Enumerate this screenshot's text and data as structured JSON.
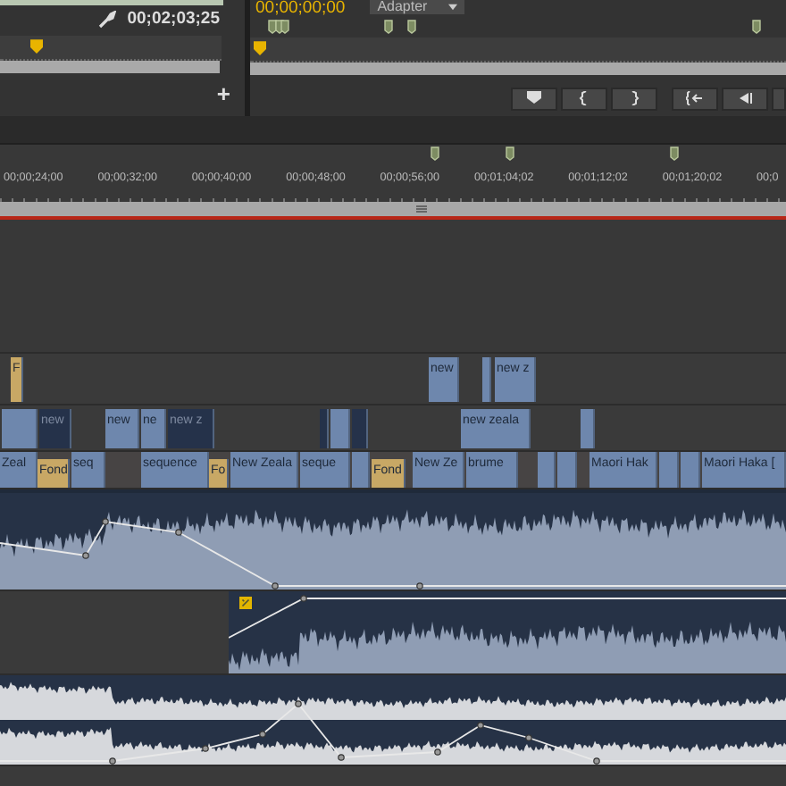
{
  "source_monitor": {
    "timecode": "00;02;03;25",
    "add_button": "+"
  },
  "program_monitor": {
    "timecode": "00;00;00;00",
    "dropdown": "Adapter"
  },
  "timeline": {
    "ruler_labels": [
      "00;00;24;00",
      "00;00;32;00",
      "00;00;40;00",
      "00;00;48;00",
      "00;00;56;00",
      "00;01;04;02",
      "00;01;12;02",
      "00;01;20;02",
      "00;0"
    ],
    "video_tracks": [
      {
        "clips": [
          {
            "label": "F",
            "kind": "gold"
          },
          {
            "label": "new",
            "kind": "normal"
          },
          {
            "kind": "normal"
          },
          {
            "label": "new z",
            "kind": "normal"
          }
        ]
      },
      {
        "clips": [
          {
            "kind": "normal"
          },
          {
            "label": "new",
            "kind": "dark"
          },
          {
            "label": "new",
            "kind": "normal"
          },
          {
            "label": "ne",
            "kind": "normal"
          },
          {
            "label": "new z",
            "kind": "dark"
          },
          {
            "kind": "dark"
          },
          {
            "kind": "normal"
          },
          {
            "kind": "dark"
          },
          {
            "label": "new zeala",
            "kind": "normal"
          },
          {
            "kind": "normal"
          }
        ]
      },
      {
        "clips": [
          {
            "label": "Zeal",
            "kind": "normal"
          },
          {
            "label": "Fond",
            "kind": "gold"
          },
          {
            "label": "seq",
            "kind": "normal"
          },
          {
            "label": "sequence",
            "kind": "normal"
          },
          {
            "label": "Fo",
            "kind": "gold"
          },
          {
            "label": "New Zeala",
            "kind": "normal"
          },
          {
            "label": "seque",
            "kind": "normal"
          },
          {
            "kind": "normal"
          },
          {
            "label": "Fond",
            "kind": "gold"
          },
          {
            "label": "New Ze",
            "kind": "normal"
          },
          {
            "label": "brume",
            "kind": "normal"
          },
          {
            "kind": "normal"
          },
          {
            "kind": "normal"
          },
          {
            "label": "Maori Hak",
            "kind": "normal"
          },
          {
            "kind": "normal"
          },
          {
            "kind": "normal"
          },
          {
            "label": "Maori Haka [",
            "kind": "normal"
          }
        ]
      }
    ]
  }
}
